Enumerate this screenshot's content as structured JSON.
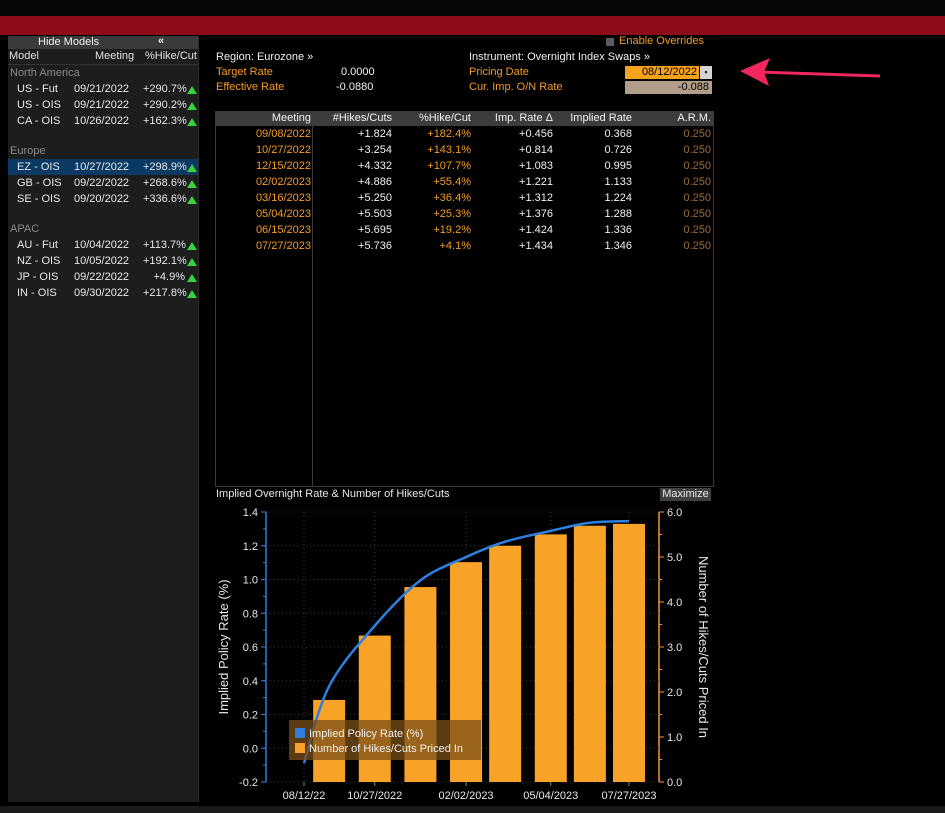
{
  "left_panel": {
    "hide_models_label": "Hide Models",
    "collapse_icon": "double-chevron-left-icon",
    "collapse_glyph": "«",
    "headers": {
      "model": "Model",
      "meeting": "Meeting",
      "pct_hike": "%Hike/Cut"
    },
    "regions": [
      {
        "name": "North America",
        "rows": [
          {
            "model": "US - Fut",
            "meeting": "09/21/2022",
            "pct": "+290.7%"
          },
          {
            "model": "US - OIS",
            "meeting": "09/21/2022",
            "pct": "+290.2%"
          },
          {
            "model": "CA - OIS",
            "meeting": "10/26/2022",
            "pct": "+162.3%"
          }
        ]
      },
      {
        "name": "Europe",
        "rows": [
          {
            "model": "EZ - OIS",
            "meeting": "10/27/2022",
            "pct": "+298.9%",
            "selected": true
          },
          {
            "model": "GB - OIS",
            "meeting": "09/22/2022",
            "pct": "+268.6%"
          },
          {
            "model": "SE - OIS",
            "meeting": "09/20/2022",
            "pct": "+336.6%"
          }
        ]
      },
      {
        "name": "APAC",
        "rows": [
          {
            "model": "AU - Fut",
            "meeting": "10/04/2022",
            "pct": "+113.7%"
          },
          {
            "model": "NZ - OIS",
            "meeting": "10/05/2022",
            "pct": "+192.1%"
          },
          {
            "model": "JP - OIS",
            "meeting": "09/22/2022",
            "pct": "+4.9%"
          },
          {
            "model": "IN - OIS",
            "meeting": "09/30/2022",
            "pct": "+217.8%"
          }
        ]
      }
    ]
  },
  "header": {
    "region": "Region: Eurozone »",
    "instrument": "Instrument: Overnight Index Swaps »",
    "target_rate_label": "Target Rate",
    "target_rate_value": "0.0000",
    "effective_rate_label": "Effective Rate",
    "effective_rate_value": "-0.0880",
    "pricing_date_label": "Pricing Date",
    "pricing_date_value": "08/12/2022",
    "on_rate_label": "Cur. Imp. O/N Rate",
    "on_rate_value": "-0.088",
    "enable_overrides": "Enable Overrides"
  },
  "table": {
    "headers": [
      "Meeting",
      "#Hikes/Cuts",
      "%Hike/Cut",
      "Imp. Rate Δ",
      "Implied Rate",
      "A.R.M."
    ],
    "rows": [
      [
        "09/08/2022",
        "+1.824",
        "+182.4%",
        "+0.456",
        "0.368",
        "0.250"
      ],
      [
        "10/27/2022",
        "+3.254",
        "+143.1%",
        "+0.814",
        "0.726",
        "0.250"
      ],
      [
        "12/15/2022",
        "+4.332",
        "+107.7%",
        "+1.083",
        "0.995",
        "0.250"
      ],
      [
        "02/02/2023",
        "+4.886",
        "+55.4%",
        "+1.221",
        "1.133",
        "0.250"
      ],
      [
        "03/16/2023",
        "+5.250",
        "+36.4%",
        "+1.312",
        "1.224",
        "0.250"
      ],
      [
        "05/04/2023",
        "+5.503",
        "+25.3%",
        "+1.376",
        "1.288",
        "0.250"
      ],
      [
        "06/15/2023",
        "+5.695",
        "+19.2%",
        "+1.424",
        "1.336",
        "0.250"
      ],
      [
        "07/27/2023",
        "+5.736",
        "+4.1%",
        "+1.434",
        "1.346",
        "0.250"
      ]
    ]
  },
  "chart_header": {
    "title": "Implied Overnight Rate & Number of Hikes/Cuts",
    "maximize": "Maximize"
  },
  "colors": {
    "accent": "#f39c24",
    "bar": "#f9a228",
    "line": "#2e7fe0",
    "up": "#39d23e",
    "header_bar": "#8c0c19"
  },
  "chart_data": {
    "type": "bar",
    "title": "Implied Overnight Rate & Number of Hikes/Cuts",
    "x_tick_labels": [
      "08/12/22",
      "10/27/2022",
      "02/02/2023",
      "05/04/2023",
      "07/27/2023"
    ],
    "categories": [
      "09/08/2022",
      "10/27/2022",
      "12/15/2022",
      "02/02/2023",
      "03/16/2023",
      "05/04/2023",
      "06/15/2023",
      "07/27/2023"
    ],
    "ylabel": "Implied Policy Rate (%)",
    "y2label": "Number of Hikes/Cuts Priced In",
    "ylim": [
      -0.2,
      1.4
    ],
    "y2lim": [
      0.0,
      6.0
    ],
    "y_ticks": [
      "1.4",
      "1.2",
      "1.0",
      "0.8",
      "0.6",
      "0.4",
      "0.2",
      "0.0",
      "-0.2"
    ],
    "y2_ticks": [
      "6.0",
      "5.0",
      "4.0",
      "3.0",
      "2.0",
      "1.0",
      "0.0"
    ],
    "series": [
      {
        "name": "Implied Policy Rate (%)",
        "type": "line",
        "x": [
          "08/12/2022",
          "09/08/2022",
          "10/27/2022",
          "12/15/2022",
          "02/02/2023",
          "03/16/2023",
          "05/04/2023",
          "06/15/2023",
          "07/27/2023"
        ],
        "values": [
          -0.088,
          0.368,
          0.726,
          0.995,
          1.133,
          1.224,
          1.288,
          1.336,
          1.346
        ]
      },
      {
        "name": "Number of Hikes/Cuts Priced In",
        "type": "bar",
        "axis": "right",
        "values": [
          1.824,
          3.254,
          4.332,
          4.886,
          5.25,
          5.503,
          5.695,
          5.736
        ]
      }
    ],
    "legend": "bottom-left",
    "grid": true
  }
}
